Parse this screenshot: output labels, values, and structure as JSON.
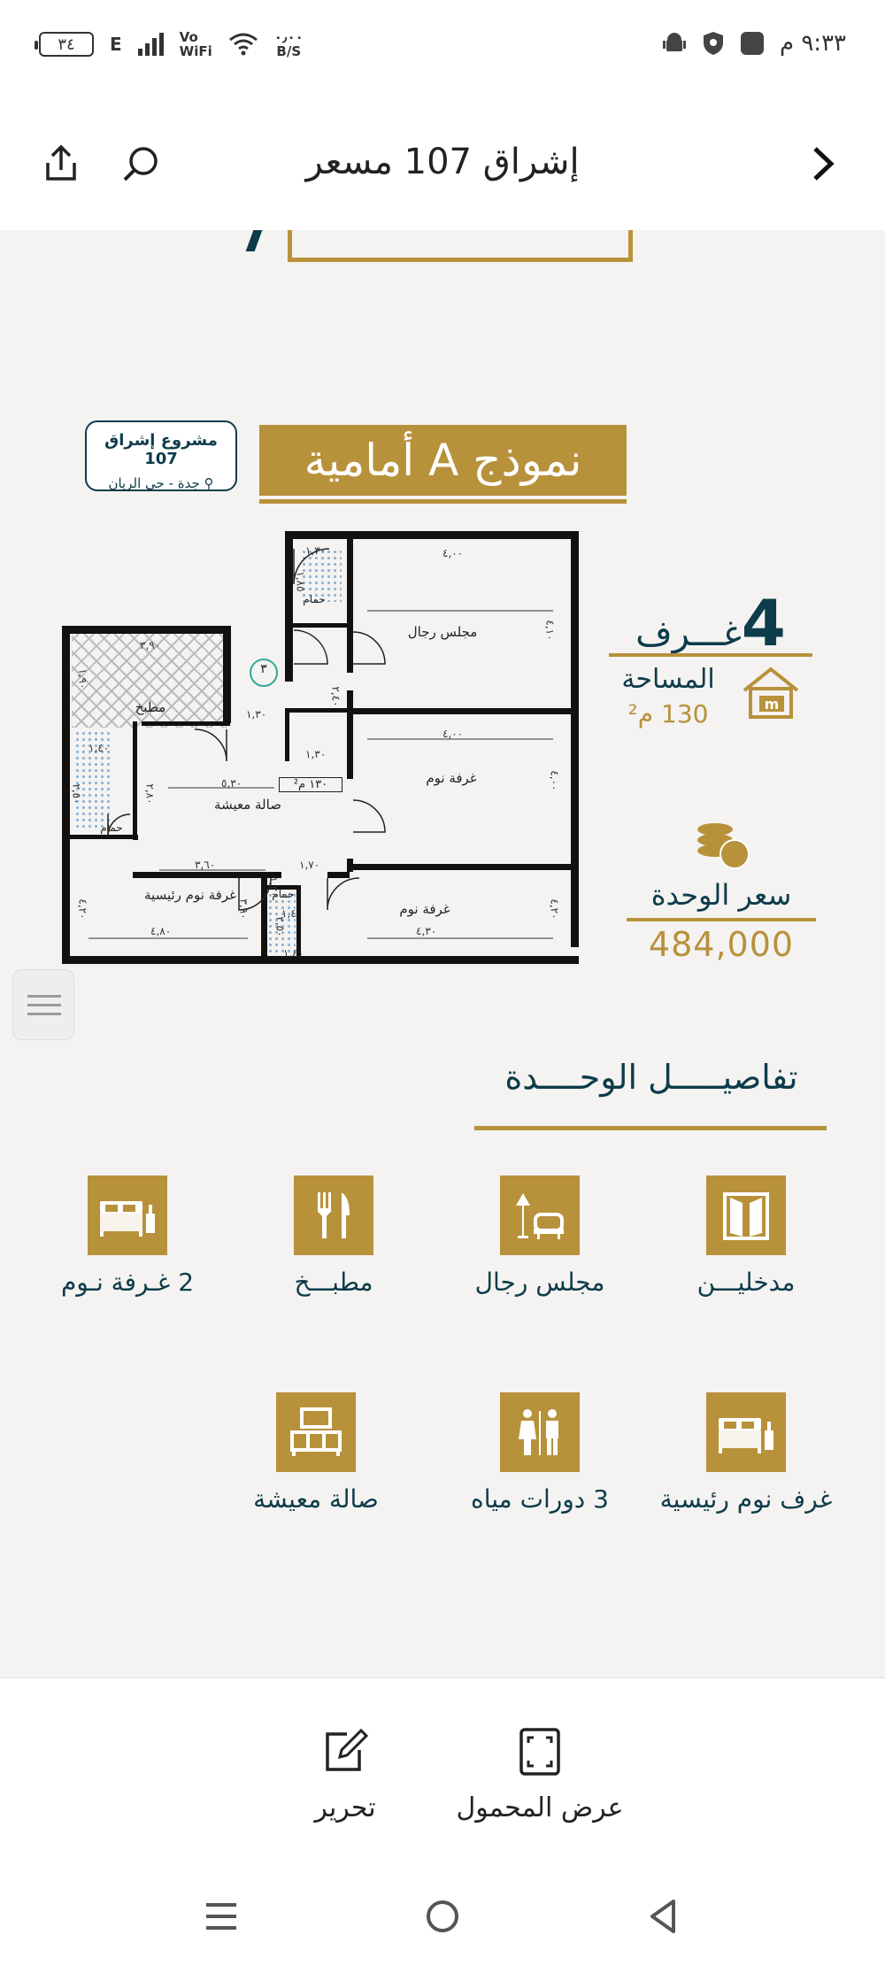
{
  "status_bar": {
    "time": "٩:٣٣ م",
    "battery": "٣٤",
    "network": "E",
    "volte": "Vo",
    "wifi_label": "WiFi",
    "speed": "٠٫٠٠",
    "speed_unit": "B/S"
  },
  "header": {
    "title": "إشراق 107 مسعر"
  },
  "brochure": {
    "model_title": "نموذج A أمامية",
    "project_name": "مشروع إشراق 107",
    "project_location": "جدة - حي الريان",
    "rooms_count": "4",
    "rooms_word": "غـــرف",
    "area_label": "المساحة",
    "area_value": "130 م²",
    "price_label": "سعر الوحدة",
    "price_value": "484,000",
    "details_title": "تفاصيـــــل الوحــــدة",
    "plan": {
      "rooms": {
        "majlis": "مجلس رجال",
        "kitchen": "مطبخ",
        "living": "صالة معيشة",
        "bedroom_1": "غرفة نوم",
        "bedroom_2": "غرفة نوم",
        "master": "غرفة نوم رئيسية",
        "bath_1": "حمام",
        "bath_2": "حمام",
        "bath_3": "حمام",
        "area_tag": "١٣٠ م²",
        "marker": "٣"
      },
      "dims": {
        "d1": "١,٣٠",
        "d2": "٤,٠٠",
        "d3": "١,٨٥",
        "d4": "٤,١٠",
        "d5": "٣,٩٠",
        "d6": "١,٩٠",
        "d7": "١,٣٠",
        "d8": "٢,٤٠",
        "d9": "١,٣٠",
        "d10": "٤,٠٠",
        "d11": "١,٤٠",
        "d12": "٥,٣٠",
        "d13": "٤,٠٠",
        "d14": "٢,٥٠",
        "d15": "٢,٨٠",
        "d16": "٣,٦٠",
        "d17": "١,٧٠",
        "d18": "١,٢٠",
        "d19": "١,٤٠",
        "d20": "٤,٢٠",
        "d21": "٣,٩٠",
        "d22": "٤,٢٠",
        "d23": "٤,٨٠",
        "d24": "٢,٥٠",
        "d25": "١,٤٠",
        "d26": "٤,٣٠"
      }
    },
    "features": [
      {
        "label": "مدخليـــن",
        "icon": "door-icon"
      },
      {
        "label": "مجلس رجال",
        "icon": "lamp-chair-icon"
      },
      {
        "label": "مطبـــخ",
        "icon": "cutlery-icon"
      },
      {
        "label": "2 غـرفة نـوم",
        "icon": "bed-icon"
      },
      {
        "label": "غرف نوم رئيسية",
        "icon": "master-bed-icon"
      },
      {
        "label": "3 دورات مياه",
        "icon": "restroom-icon"
      },
      {
        "label": "صالة معيشة",
        "icon": "tv-icon"
      }
    ]
  },
  "toolbar": {
    "portable_view": "عرض المحمول",
    "edit": "تحرير"
  },
  "colors": {
    "gold": "#b8913b",
    "navy": "#0d3c4a"
  }
}
